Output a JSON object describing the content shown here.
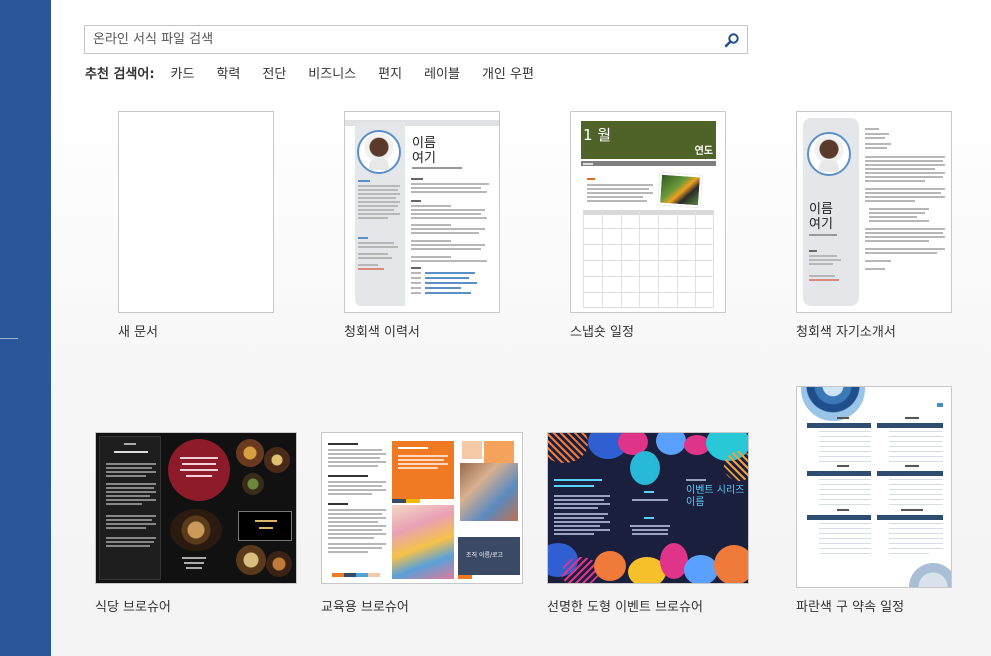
{
  "search": {
    "placeholder": "온라인 서식 파일 검색"
  },
  "suggested": {
    "label": "추천 검색어:",
    "keywords": [
      "카드",
      "학력",
      "전단",
      "비즈니스",
      "편지",
      "레이블",
      "개인 우편"
    ]
  },
  "templates": [
    {
      "label": "새 문서"
    },
    {
      "label": "청회색 이력서",
      "name_text": "이름\n여기"
    },
    {
      "label": "스냅숏 일정",
      "month": "1 월",
      "year": "연도"
    },
    {
      "label": "청회색 자기소개서",
      "name_text": "이름\n여기"
    },
    {
      "label": "식당 브로슈어"
    },
    {
      "label": "교육용 브로슈어",
      "org_text": "조직 이름/로고"
    },
    {
      "label": "선명한 도형 이벤트 브로슈어",
      "title_text": "이벤트 시리즈\n이름"
    },
    {
      "label": "파란색 구 약속 일정"
    }
  ],
  "colors": {
    "sidebar": "#2b579a",
    "calendar_green": "#4f6228",
    "restaurant_red": "#8e1b2a",
    "edu_orange": "#f07a23",
    "event_navy": "#1a1f3d"
  }
}
